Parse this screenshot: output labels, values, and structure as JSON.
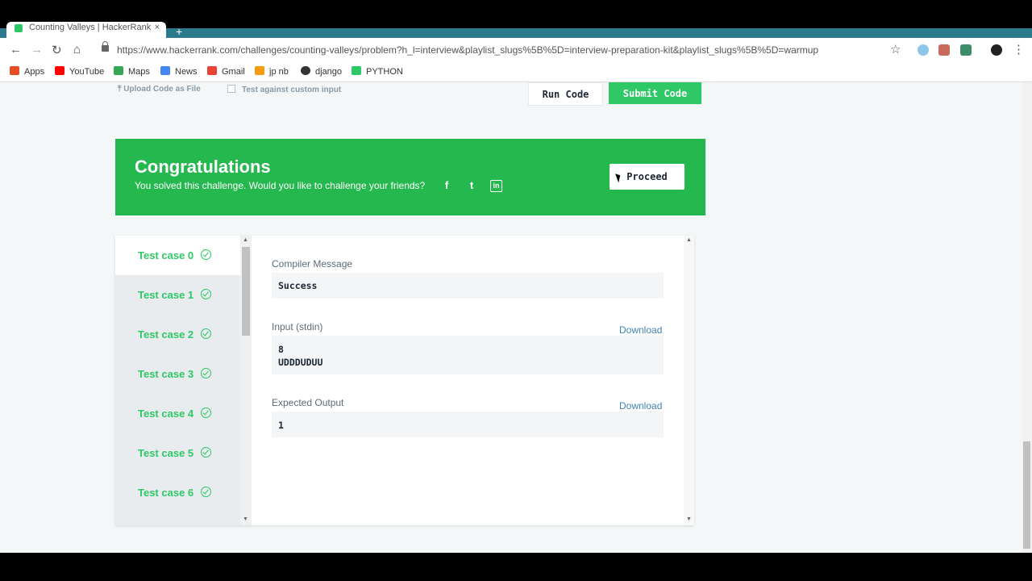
{
  "browser": {
    "tab_title": "Counting Valleys | HackerRank",
    "tab_close": "×",
    "new_tab": "+",
    "url": "https://www.hackerrank.com/challenges/counting-valleys/problem?h_l=interview&playlist_slugs%5B%5D=interview-preparation-kit&playlist_slugs%5B%5D=warmup",
    "nav": {
      "back": "←",
      "forward": "→",
      "reload": "↻",
      "home": "⌂",
      "star": "☆",
      "menu": "⋮"
    },
    "bookmarks": [
      {
        "label": "Apps",
        "color": "#e44d26"
      },
      {
        "label": "YouTube",
        "color": "#ff0000"
      },
      {
        "label": "Maps",
        "color": "#34a853"
      },
      {
        "label": "News",
        "color": "#4285f4"
      },
      {
        "label": "Gmail",
        "color": "#ea4335"
      },
      {
        "label": "jp nb",
        "color": "#f39c12"
      },
      {
        "label": "django",
        "color": "#333333"
      },
      {
        "label": "PYTHON",
        "color": "#2ec866"
      }
    ]
  },
  "editor_actions": {
    "upload": "⤒ Upload Code as File",
    "custom_input": "Test against custom input",
    "run_code": "Run Code",
    "submit_code": "Submit Code"
  },
  "congrats": {
    "title": "Congratulations",
    "message": "You solved this challenge. Would you like to challenge your friends?",
    "proceed": "Proceed",
    "social": [
      "f",
      "t",
      "in"
    ]
  },
  "test_cases": [
    "Test case 0",
    "Test case 1",
    "Test case 2",
    "Test case 3",
    "Test case 4",
    "Test case 5",
    "Test case 6"
  ],
  "result": {
    "compiler_label": "Compiler Message",
    "compiler_value": "Success",
    "input_label": "Input (stdin)",
    "input_line1": "8",
    "input_line2": "UDDDUDUU",
    "download": "Download",
    "expected_label": "Expected Output",
    "expected_value": "1"
  },
  "colors": {
    "accent": "#2ec866",
    "banner": "#25b84f",
    "link": "#3d82b4"
  }
}
